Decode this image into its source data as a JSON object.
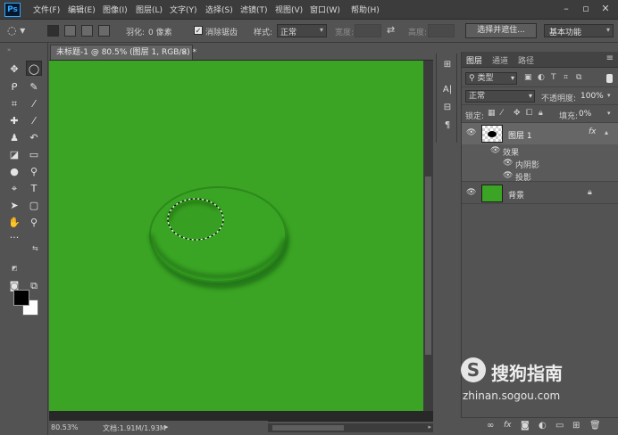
{
  "app": {
    "logo": "Ps"
  },
  "menu": [
    "文件(F)",
    "编辑(E)",
    "图像(I)",
    "图层(L)",
    "文字(Y)",
    "选择(S)",
    "滤镜(T)",
    "视图(V)",
    "窗口(W)",
    "帮助(H)"
  ],
  "options": {
    "feather_label": "羽化:",
    "feather_value": "0 像素",
    "antialias_label": "消除锯齿",
    "style_label": "样式:",
    "style_value": "正常",
    "width_label": "宽度:",
    "height_label": "高度:",
    "select_mask_button": "选择并遮住...",
    "workspace_value": "基本功能"
  },
  "document": {
    "tab_title": "未标题-1 @ 80.5% (图层 1, RGB/8) *",
    "zoom": "80.53%",
    "doc_size": "文档:1.91M/1.93M",
    "canvas_color": "#3ba424"
  },
  "layers_panel": {
    "tabs": [
      "图层",
      "通道",
      "路径"
    ],
    "filter_kind": "类型",
    "blend_mode": "正常",
    "opacity_label": "不透明度:",
    "opacity_value": "100%",
    "lock_label": "锁定:",
    "fill_label": "填充:",
    "fill_value": "0%",
    "layers": [
      {
        "name": "图层 1",
        "fx": "fx",
        "effects_label": "效果",
        "effects": [
          "内阴影",
          "投影"
        ]
      },
      {
        "name": "背景"
      }
    ]
  },
  "watermark": {
    "brand": "搜狗指南",
    "url": "zhinan.sogou.com"
  },
  "icons": {
    "tools": [
      "move-icon",
      "marquee-icon",
      "lasso-icon",
      "quick-select-icon",
      "crop-icon",
      "eyedropper-icon",
      "healing-icon",
      "brush-icon",
      "stamp-icon",
      "history-brush-icon",
      "eraser-icon",
      "gradient-icon",
      "blur-icon",
      "dodge-icon",
      "pen-icon",
      "type-icon",
      "path-select-icon",
      "shape-icon",
      "hand-icon",
      "zoom-icon"
    ]
  }
}
